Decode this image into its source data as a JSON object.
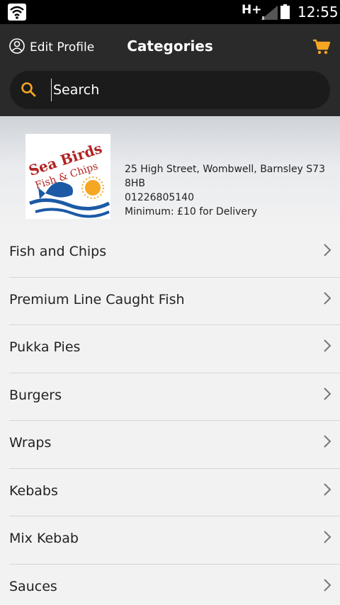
{
  "status_bar": {
    "network_type": "H+",
    "time": "12:55",
    "icons": [
      "wifi-icon",
      "signal-icon",
      "battery-icon"
    ]
  },
  "header": {
    "edit_profile_label": "Edit Profile",
    "title": "Categories",
    "icons": [
      "user-icon",
      "cart-icon"
    ]
  },
  "search": {
    "placeholder": "Search"
  },
  "restaurant": {
    "logo_text_line1": "Sea Birds",
    "logo_text_line2": "Fish & Chips",
    "address": "25 High Street, Wombwell, Barnsley S73 8HB",
    "phone": "01226805140",
    "minimum": "Minimum: £10 for Delivery"
  },
  "categories": [
    {
      "label": "Fish and Chips"
    },
    {
      "label": "Premium Line Caught Fish"
    },
    {
      "label": "Pukka Pies"
    },
    {
      "label": "Burgers"
    },
    {
      "label": "Wraps"
    },
    {
      "label": "Kebabs"
    },
    {
      "label": "Mix Kebab"
    },
    {
      "label": "Sauces"
    }
  ],
  "colors": {
    "accent": "#f5a623",
    "header_bg": "#2a2a2a",
    "list_bg": "#f2f2f2"
  }
}
